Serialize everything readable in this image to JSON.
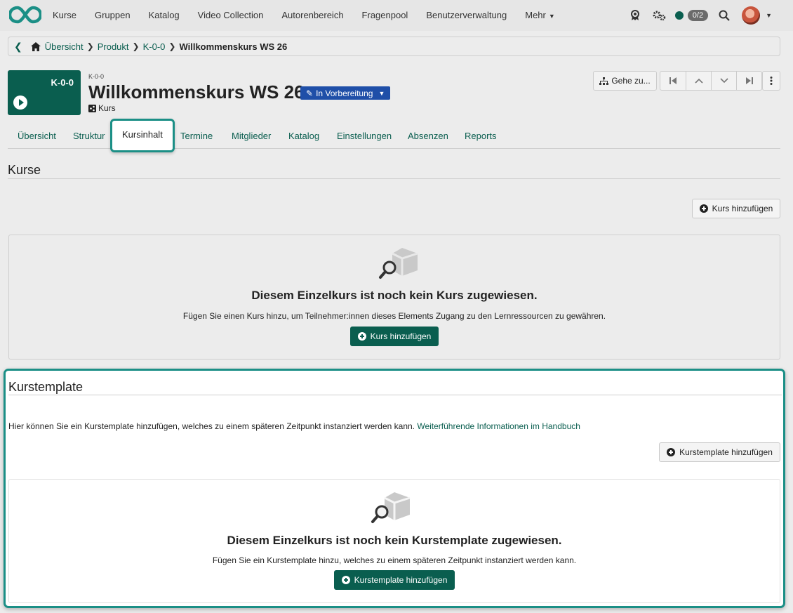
{
  "topnav": {
    "items": [
      "Kurse",
      "Gruppen",
      "Katalog",
      "Video Collection",
      "Autorenbereich",
      "Fragenpool",
      "Benutzerverwaltung",
      "Mehr"
    ],
    "badge": "0/2",
    "icons": [
      "award-icon",
      "gears-icon",
      "status-dot",
      "search-icon",
      "avatar"
    ]
  },
  "breadcrumb": {
    "items": [
      "Übersicht",
      "Produkt",
      "K-0-0"
    ],
    "current": "Willkommenskurs WS 26"
  },
  "course": {
    "thumb_code": "K-0-0",
    "small_code": "K-0-0",
    "title": "Willkommenskurs WS 26",
    "status": "In Vorbereitung",
    "type": "Kurs",
    "goto_label": "Gehe zu..."
  },
  "tabs": [
    "Übersicht",
    "Struktur",
    "Kursinhalt",
    "Termine",
    "Mitglieder",
    "Katalog",
    "Einstellungen",
    "Absenzen",
    "Reports"
  ],
  "active_tab": "Kursinhalt",
  "kurse": {
    "title": "Kurse",
    "add_button": "Kurs hinzufügen",
    "empty_title": "Diesem Einzelkurs ist noch kein Kurs zugewiesen.",
    "empty_desc": "Fügen Sie einen Kurs hinzu, um Teilnehmer:innen dieses Elements Zugang zu den Lernressourcen zu gewähren.",
    "empty_button": "Kurs hinzufügen"
  },
  "template": {
    "title": "Kurstemplate",
    "desc": "Hier können Sie ein Kurstemplate hinzufügen, welches zu einem späteren Zeitpunkt instanziert werden kann.",
    "link": "Weiterführende Informationen im Handbuch",
    "add_button": "Kurstemplate hinzufügen",
    "empty_title": "Diesem Einzelkurs ist noch kein Kurstemplate zugewiesen.",
    "empty_desc": "Fügen Sie ein Kurstemplate hinzu, welches zu einem späteren Zeitpunkt instanziert werden kann.",
    "empty_button": "Kurstemplate hinzufügen"
  },
  "colors": {
    "brand": "#0a5e4f",
    "status_pill": "#1f4fa8",
    "highlight": "#1b8f86"
  }
}
